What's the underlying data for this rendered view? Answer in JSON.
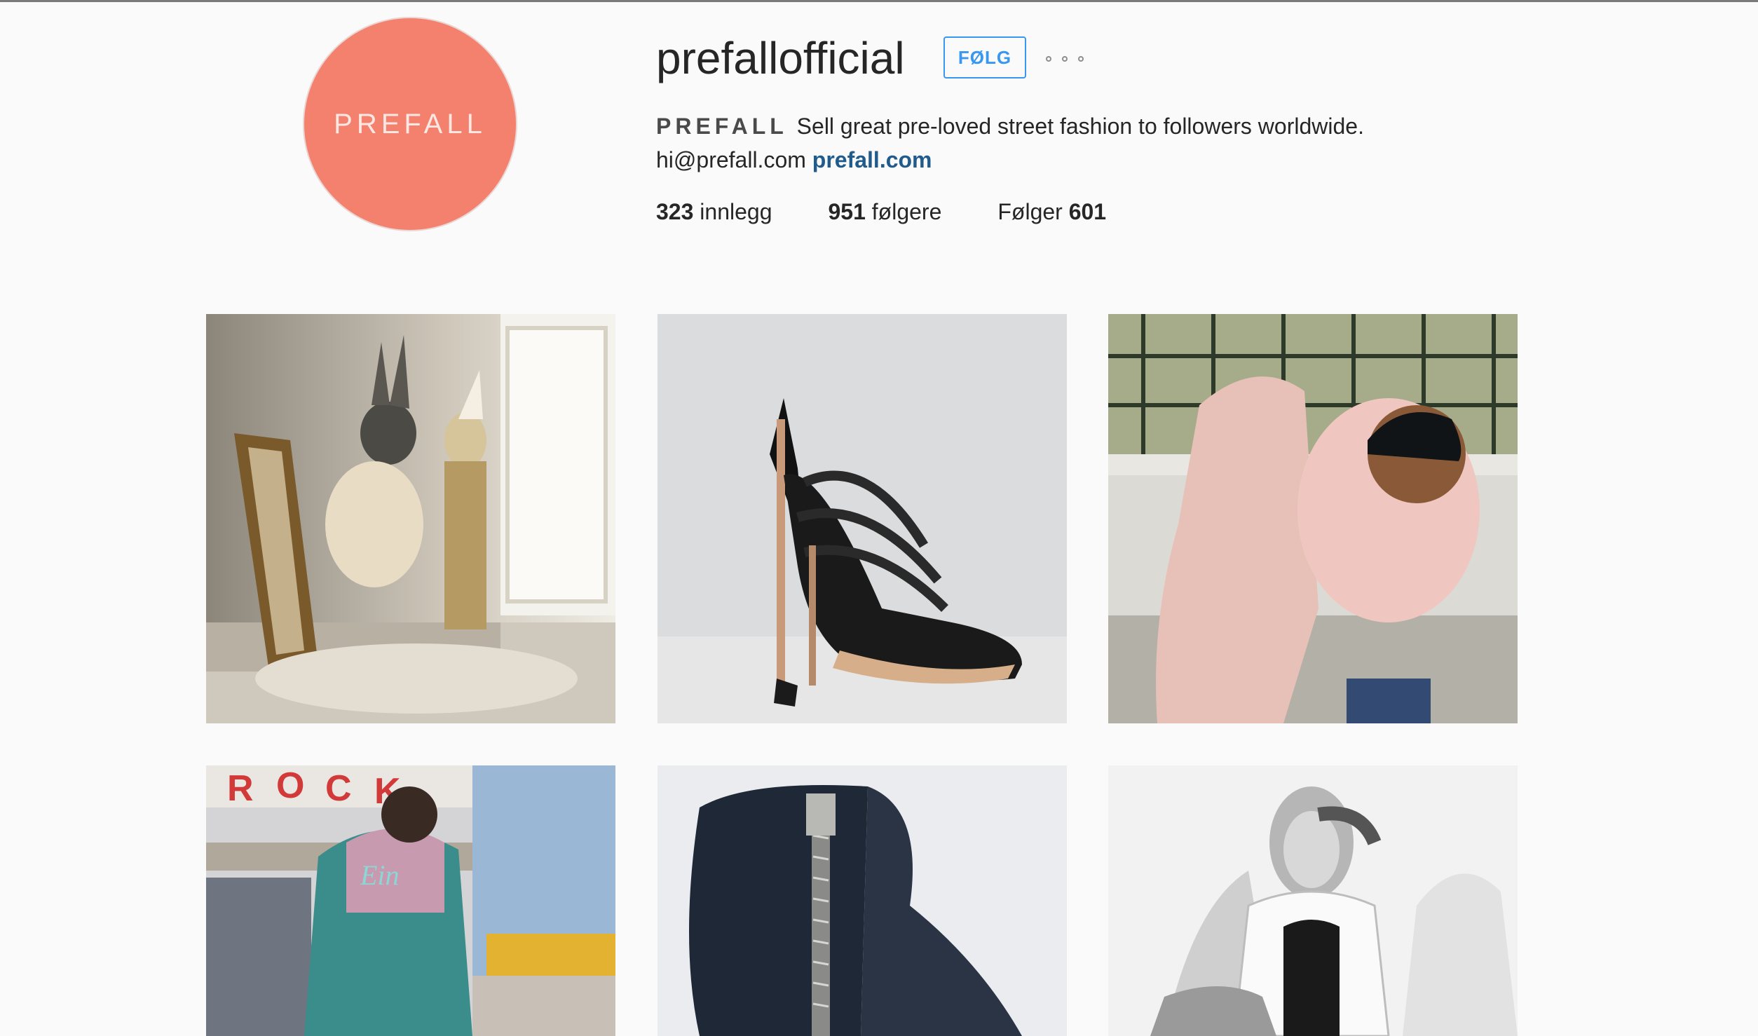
{
  "profile": {
    "avatar_text": "PREFALL",
    "username": "prefallofficial",
    "follow_label": "FØLG",
    "bio_name": "PREFALL",
    "bio_text": "Sell great pre-loved street fashion to followers worldwide.",
    "email": "hi@prefall.com",
    "website": "prefall.com"
  },
  "stats": {
    "posts_count": "323",
    "posts_label": "innlegg",
    "followers_count": "951",
    "followers_label": "følgere",
    "following_label": "Følger",
    "following_count": "601"
  },
  "colors": {
    "avatar_bg": "#f4806e",
    "follow_accent": "#3897f0",
    "link": "#1f5b8c"
  },
  "posts_visible": 6
}
